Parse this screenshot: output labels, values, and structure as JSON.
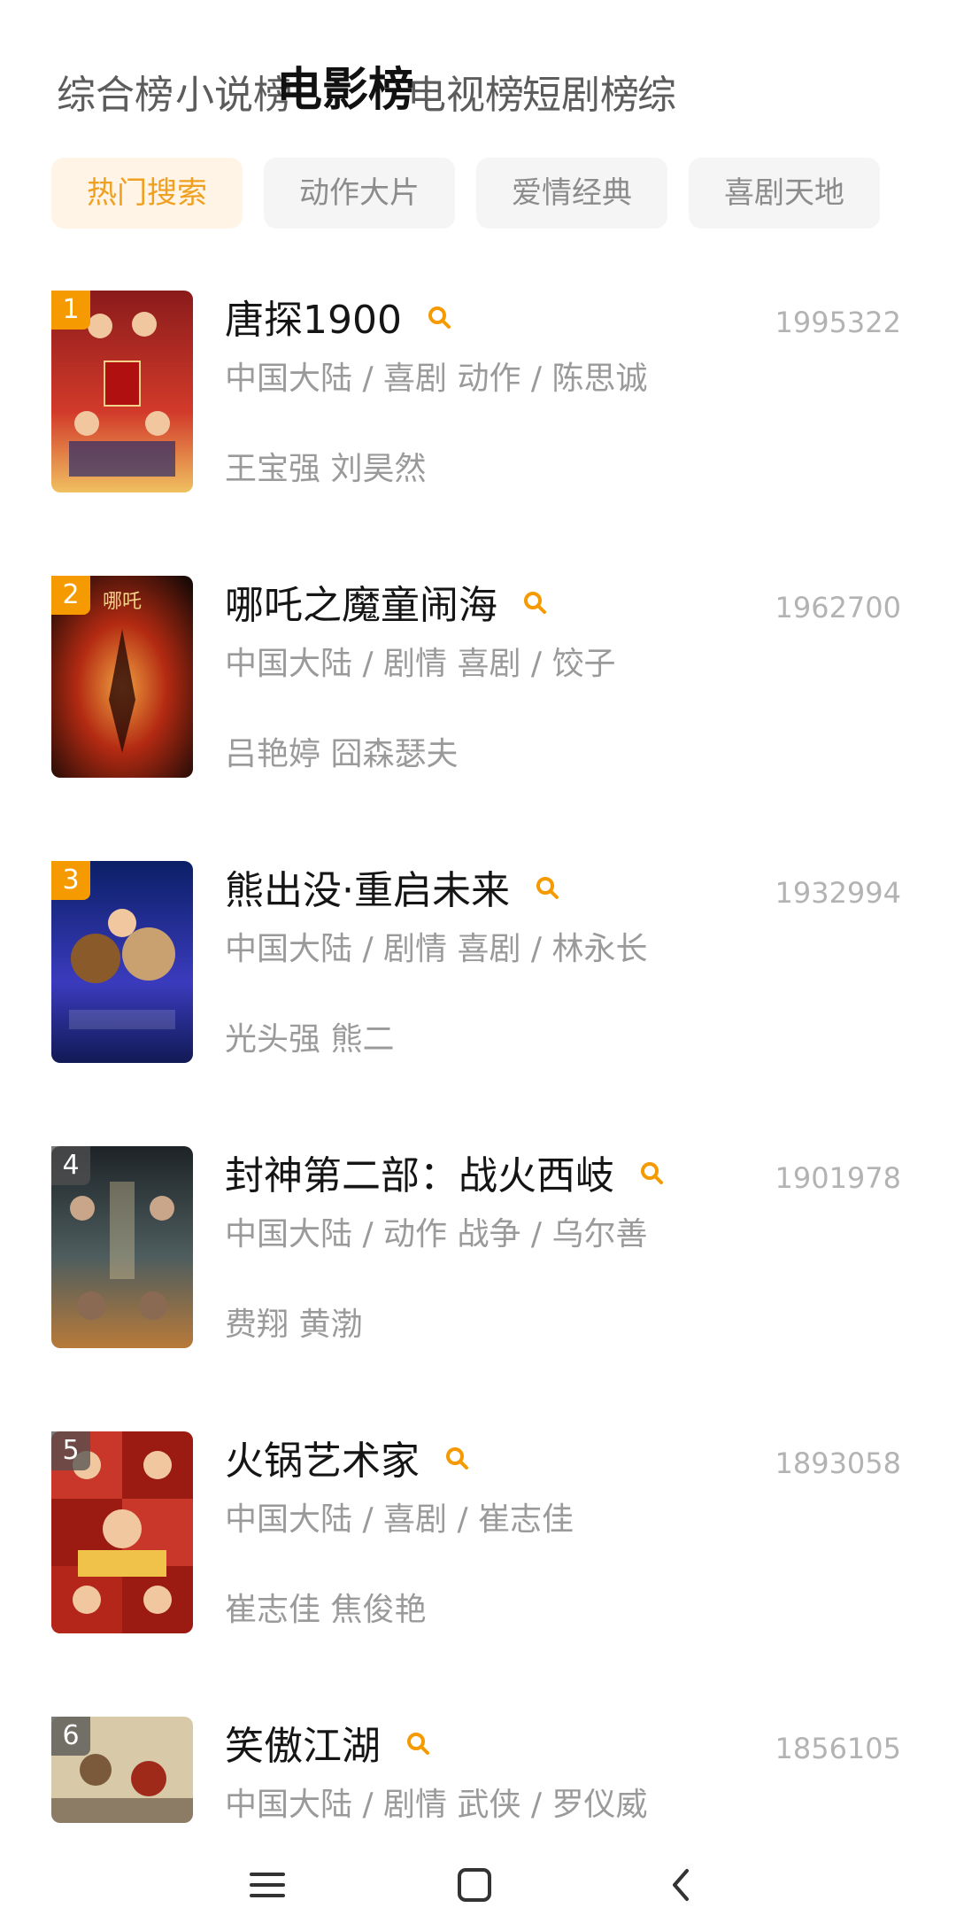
{
  "tabs": [
    "综合榜",
    "小说榜",
    "电影榜",
    "电视榜",
    "短剧榜",
    "综"
  ],
  "active_tab": "电影榜",
  "chips": [
    "热门搜索",
    "动作大片",
    "爱情经典",
    "喜剧天地"
  ],
  "movies": [
    {
      "rank": "1",
      "title": "唐探1900",
      "score": "1995322",
      "meta": "中国大陆 / 喜剧 动作 / 陈思诚",
      "cast": "王宝强 刘昊然",
      "poster_colors": [
        "#8a1b1b",
        "#d23a2a",
        "#f0c060"
      ]
    },
    {
      "rank": "2",
      "title": "哪吒之魔童闹海",
      "score": "1962700",
      "meta": "中国大陆 / 剧情 喜剧 / 饺子",
      "cast": "吕艳婷 囧森瑟夫",
      "poster_colors": [
        "#1b0a06",
        "#b32a12",
        "#f08a2a"
      ]
    },
    {
      "rank": "3",
      "title": "熊出没·重启未来",
      "score": "1932994",
      "meta": "中国大陆 / 剧情 喜剧 / 林永长",
      "cast": "光头强 熊二",
      "poster_colors": [
        "#0b1f66",
        "#3a3bbd",
        "#e0b060"
      ]
    },
    {
      "rank": "4",
      "title": "封神第二部：战火西岐",
      "score": "1901978",
      "meta": "中国大陆 / 动作 战争 / 乌尔善",
      "cast": "费翔 黄渤",
      "poster_colors": [
        "#1d2327",
        "#4e5d5e",
        "#b87a3a"
      ]
    },
    {
      "rank": "5",
      "title": "火锅艺术家",
      "score": "1893058",
      "meta": "中国大陆 / 喜剧 / 崔志佳",
      "cast": "崔志佳 焦俊艳",
      "poster_colors": [
        "#9b1a12",
        "#d8461f",
        "#f0c24a"
      ]
    },
    {
      "rank": "6",
      "title": "笑傲江湖",
      "score": "1856105",
      "meta": "中国大陆 / 剧情 武侠 / 罗仪威",
      "cast": "",
      "poster_colors": [
        "#d8c9a8",
        "#7a5a3a",
        "#a02a1a"
      ]
    }
  ],
  "accent_color": "#f59a00",
  "nav": [
    "menu-icon",
    "home-icon",
    "back-icon"
  ]
}
